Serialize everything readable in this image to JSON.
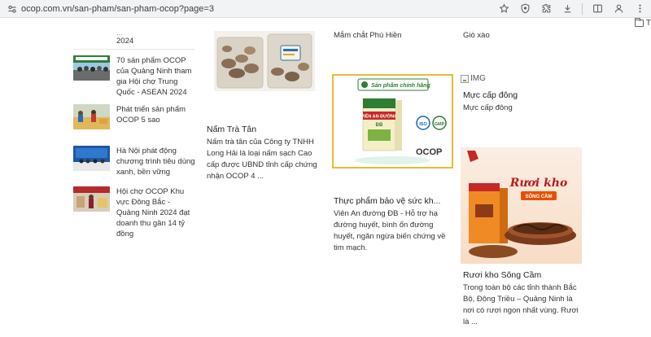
{
  "browser": {
    "url": "ocop.com.vn/san-pham/san-pham-ocop?page=3",
    "bookmarks_folder_label": "T"
  },
  "sidebar": {
    "cut_off_text": [
      "...",
      "2024"
    ],
    "items": [
      {
        "title": "70 sản phẩm OCOP của Quảng Ninh tham gia Hội chợ Trung Quốc - ASEAN 2024"
      },
      {
        "title": "Phát triển sản phẩm OCOP 5 sao"
      },
      {
        "title": "Hà Nội phát động chương trình tiêu dùng xanh, bền vững"
      },
      {
        "title": "Hội chợ OCOP Khu vực Đông Bắc - Quảng Ninh 2024 đạt doanh thu gần 14 tỷ đồng"
      }
    ]
  },
  "products": {
    "top_text_col2": "Mắm chắt Phú Hiền",
    "top_text_col3": "Giò xào",
    "nam_tra_tan": {
      "title": "Nấm Trà Tân",
      "desc": "Nấm trà tân của Công ty TNHH Long Hải là loại nấm sạch Cao cấp được UBND tỉnh cấp chứng nhận OCOP 4 ..."
    },
    "thuc_pham": {
      "title": "Thực phẩm bảo vệ sức kh...",
      "desc": "Viên An đường ĐB - Hỗ trợ hạ đường huyết, bình ổn đường huyết, ngăn ngừa biến chứng về tim mạch.",
      "badge": "Sản phẩm chính hãng",
      "box_label": "VIÊN AN ĐƯỜNG",
      "box_sub": "ĐB",
      "logo_ocop": "OCOP",
      "cert_1": "ISO",
      "cert_2": "GMP"
    },
    "muc_cap_dong": {
      "img_alt": "IMG",
      "title": "Mực cấp đông",
      "desc": "Mực cấp đông"
    },
    "ruoi_kho": {
      "title": "Rươi kho Sông Cầm",
      "desc": "Trong toàn bộ các tỉnh thành Bắc Bộ, Đông Triều – Quảng Ninh là nơi có rươi ngon nhất vùng. Rươi là ...",
      "img_title": "Rươi kho",
      "img_sub": "SÔNG CẦM"
    }
  },
  "colors": {
    "accent_gold": "#e8b93a",
    "ocop_green": "#2e7d32",
    "ruoi_orange": "#f08a24"
  }
}
